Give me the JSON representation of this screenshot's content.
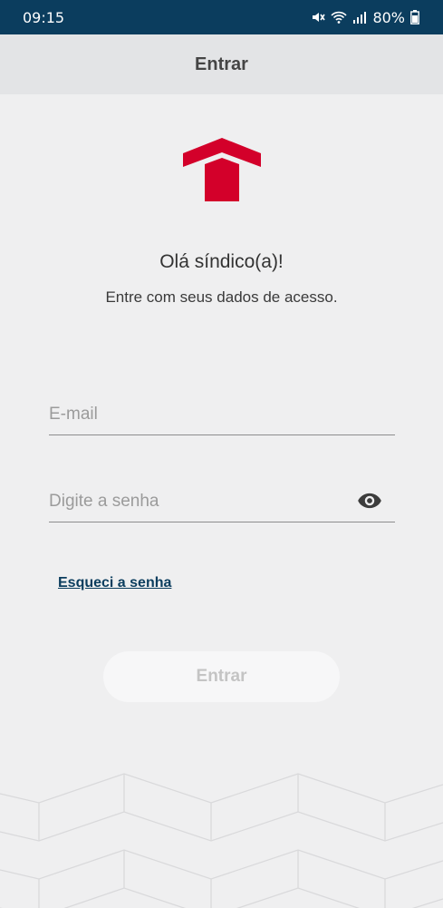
{
  "status_bar": {
    "time": "09:15",
    "battery": "80%"
  },
  "header": {
    "title": "Entrar"
  },
  "brand": {
    "color": "#d3002a",
    "accent": "#0b3d5e"
  },
  "greeting": "Olá síndico(a)!",
  "subtitle": "Entre com seus dados de acesso.",
  "form": {
    "email_placeholder": "E-mail",
    "password_placeholder": "Digite a senha",
    "forgot_link": "Esqueci a senha",
    "submit_label": "Entrar"
  },
  "icons": {
    "show_password": "eye-icon",
    "logo": "house-logo",
    "status": [
      "mute-icon",
      "wifi-icon",
      "signal-icon",
      "battery-icon"
    ]
  }
}
